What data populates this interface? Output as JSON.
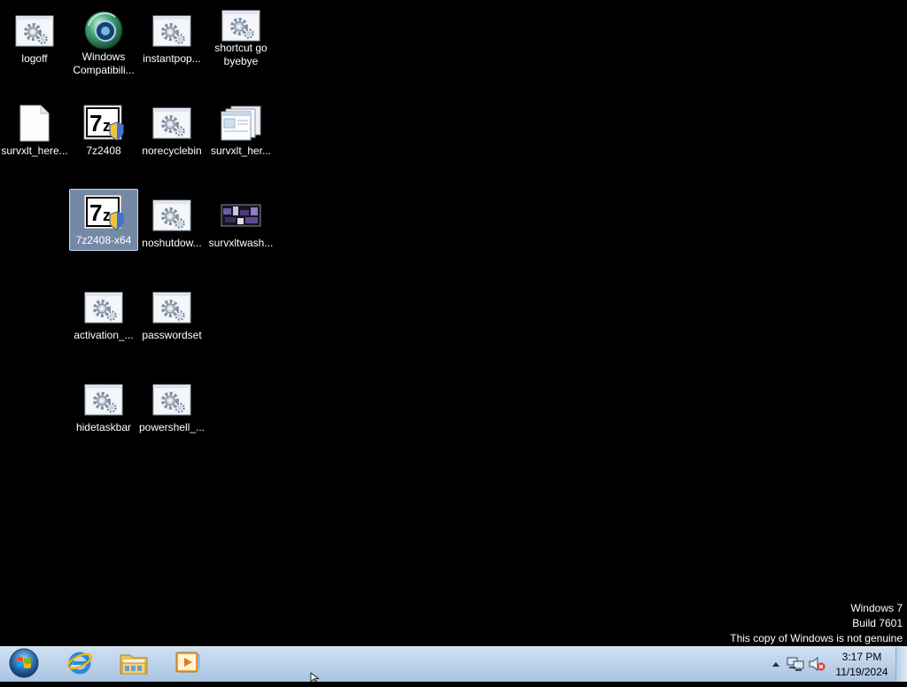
{
  "desktop": {
    "icons": [
      {
        "label": "logoff",
        "icon": "script-settings-icon"
      },
      {
        "label": "Windows\nCompatibili...",
        "icon": "browser-globe-icon"
      },
      {
        "label": "instantpop...",
        "icon": "script-settings-icon"
      },
      {
        "label": "shortcut go\nbyebye",
        "icon": "script-settings-icon"
      },
      {
        "label": "survxlt_here...",
        "icon": "blank-file-icon"
      },
      {
        "label": "7z2408",
        "icon": "7zip-installer-icon"
      },
      {
        "label": "norecyclebin",
        "icon": "script-settings-icon"
      },
      {
        "label": "survxlt_her...",
        "icon": "window-files-icon"
      },
      {
        "label": "7z2408-x64",
        "icon": "7zip-installer-icon"
      },
      {
        "label": "noshutdow...",
        "icon": "script-settings-icon"
      },
      {
        "label": "survxltwash...",
        "icon": "video-thumbnail-icon"
      },
      {
        "label": "activation_...",
        "icon": "script-settings-icon"
      },
      {
        "label": "passwordset",
        "icon": "script-settings-icon"
      },
      {
        "label": "hidetaskbar",
        "icon": "script-settings-icon"
      },
      {
        "label": "powershell_...",
        "icon": "script-settings-icon"
      }
    ],
    "selected_icon": "7z2408-x64"
  },
  "watermark": {
    "line1": "Windows 7",
    "line2": "Build 7601",
    "line3": "This copy of Windows is not genuine"
  },
  "taskbar": {
    "start_icon": "windows-start-orb-icon",
    "pinned": [
      "internet-explorer-icon",
      "file-explorer-icon",
      "media-player-icon"
    ],
    "tray": [
      "show-hidden-icons-arrow",
      "network-icon",
      "volume-muted-icon"
    ],
    "clock_time": "3:17 PM",
    "clock_date": "11/19/2024"
  },
  "colors": {
    "desktop_background": "#000000",
    "taskbar": "#bcd3ec",
    "selection": "#a0bee6"
  }
}
